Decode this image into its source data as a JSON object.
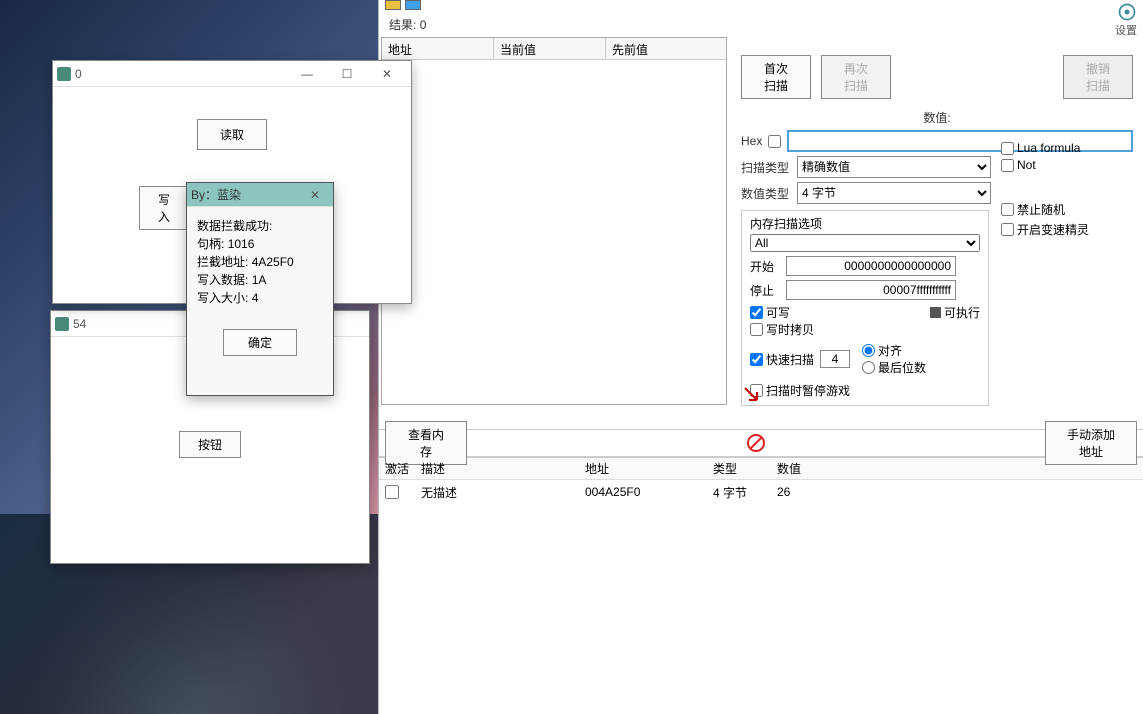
{
  "win0": {
    "title": "0",
    "read_btn": "读取",
    "write_btn": "写入"
  },
  "win54": {
    "title": "54",
    "button_btn": "按钮"
  },
  "dlg": {
    "title": "By：蓝染",
    "l1": "数据拦截成功:",
    "l2_label": "句柄:",
    "l2_val": "1016",
    "l3_label": "拦截地址:",
    "l3_val": "4A25F0",
    "l4_label": "写入数据:",
    "l4_val": "1A",
    "l5_label": "写入大小:",
    "l5_val": "4",
    "ok": "确定"
  },
  "ce": {
    "settings": "设置",
    "results_label": "结果:",
    "results_count": "0",
    "cols": {
      "addr": "地址",
      "cur": "当前值",
      "prev": "先前值"
    },
    "btn_first": "首次扫描",
    "btn_next": "再次扫描",
    "btn_undo": "撤销扫描",
    "value_label": "数值:",
    "hex_label": "Hex",
    "scan_type_label": "扫描类型",
    "scan_type_val": "精确数值",
    "value_type_label": "数值类型",
    "value_type_val": "4 字节",
    "lua_label": "Lua formula",
    "not_label": "Not",
    "mem_opts": "内存扫描选项",
    "mem_all": "All",
    "start_label": "开始",
    "start_val": "0000000000000000",
    "stop_label": "停止",
    "stop_val": "00007fffffffffff",
    "writable": "可写",
    "exec": "可执行",
    "cow": "写时拷贝",
    "fast_label": "快速扫描",
    "fast_val": "4",
    "align": "对齐",
    "lastdigit": "最后位数",
    "pause_label": "扫描时暂停游戏",
    "no_random": "禁止随机",
    "speedhack": "开启变速精灵",
    "view_mem": "查看内存",
    "add_manual": "手动添加地址",
    "addr_cols": {
      "active": "激活",
      "desc": "描述",
      "addr": "地址",
      "type": "类型",
      "val": "数值"
    },
    "rows": [
      {
        "desc": "无描述",
        "addr": "004A25F0",
        "type": "4 字节",
        "val": "26"
      }
    ]
  }
}
